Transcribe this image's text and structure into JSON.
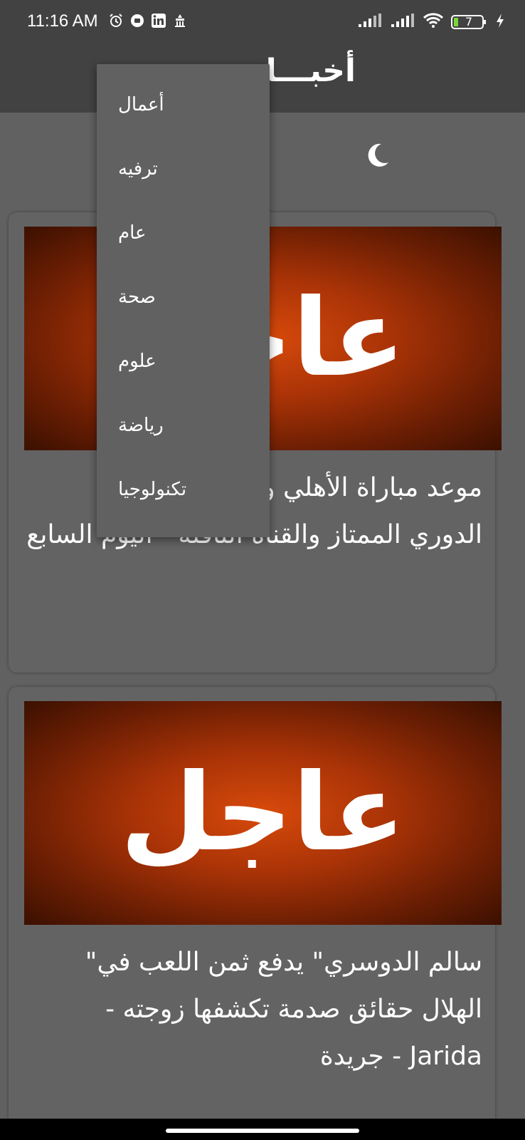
{
  "status_bar": {
    "time": "11:16 AM",
    "battery": "7"
  },
  "app_bar": {
    "title": "أخبـــار"
  },
  "menu": {
    "items": [
      "أعمال",
      "ترفيه",
      "عام",
      "صحة",
      "علوم",
      "رياضة",
      "تكنولوجيا"
    ]
  },
  "articles": [
    {
      "image_text": "عاجل",
      "title": "موعد مباراة الأهلي والبنك الأهلي فى الدوري الممتاز والقناة الناقلة - اليوم السابع"
    },
    {
      "image_text": "عاجل",
      "title": "سالم الدوسري\" يدفع ثمن اللعب في\" الهلال حقائق صدمة تكشفها زوجته - Jarida - جريدة"
    }
  ],
  "colors": {
    "background": "#616161",
    "app_bar": "#424242",
    "accent": "#d84a0b"
  }
}
